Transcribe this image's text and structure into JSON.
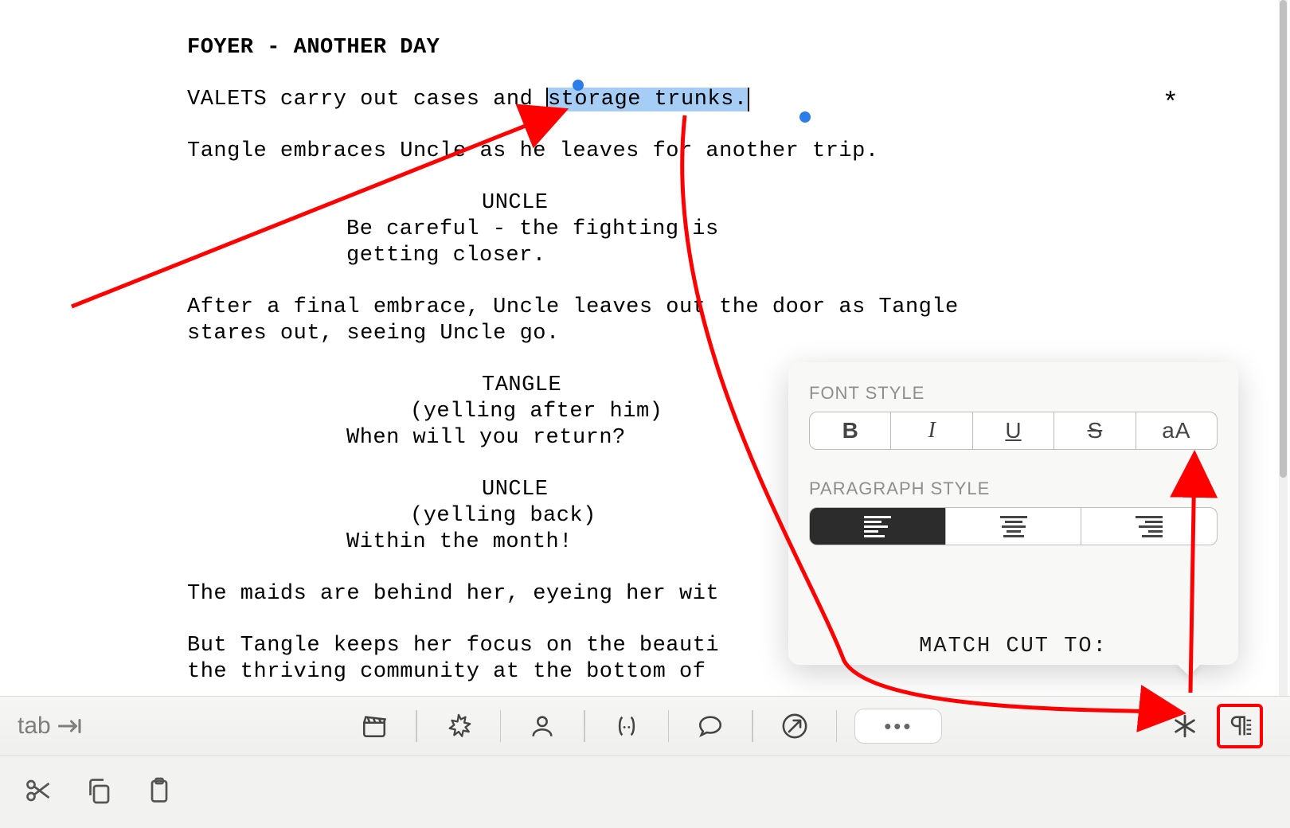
{
  "script": {
    "scene_heading": "FOYER - ANOTHER DAY",
    "action1_pre": "VALETS carry out cases and ",
    "action1_sel": "storage trunks.",
    "action2": "Tangle embraces Uncle as he leaves for another trip.",
    "uncle1_name": "UNCLE",
    "uncle1_line1": "Be careful - the fighting is",
    "uncle1_line2": "getting closer.",
    "action3_line1": "After a final embrace, Uncle leaves out the door as Tangle",
    "action3_line2": "stares out, seeing Uncle go.",
    "tangle_name": "TANGLE",
    "tangle_paren": "(yelling after him)",
    "tangle_line": "When will you return?",
    "uncle2_name": "UNCLE",
    "uncle2_paren": "(yelling back)",
    "uncle2_line": "Within the month!",
    "action4": "The maids are behind her, eyeing her wit",
    "action5_line1": "But Tangle keeps her focus on the beauti",
    "action5_line2": "the thriving community at the bottom of",
    "transition_peek": "MATCH CUT TO:"
  },
  "revision_mark": "*",
  "popover": {
    "font_style_label": "FONT STYLE",
    "paragraph_style_label": "PARAGRAPH STYLE",
    "bold": "B",
    "italic": "I",
    "underline": "U",
    "strike": "S",
    "case": "aA"
  },
  "toolbar": {
    "tab_label": "tab",
    "more": "•••"
  }
}
